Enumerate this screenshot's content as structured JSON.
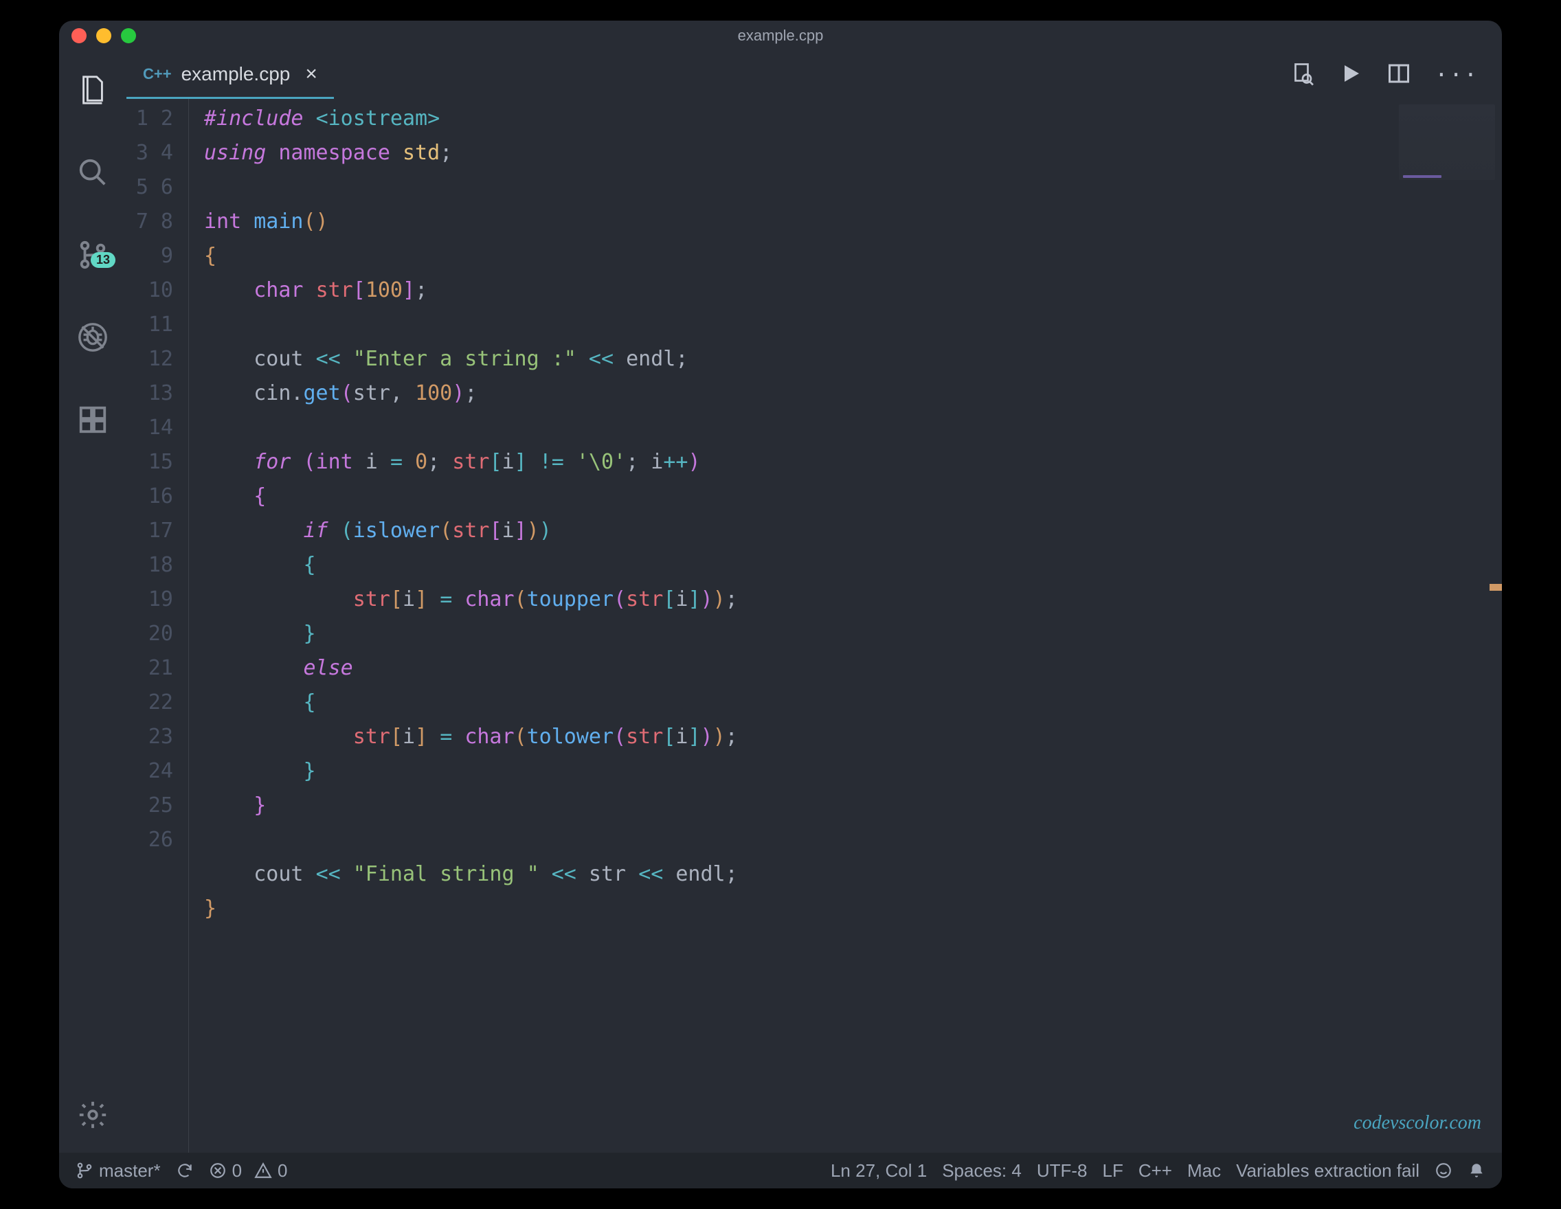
{
  "window": {
    "title": "example.cpp"
  },
  "tab": {
    "lang_badge": "C++",
    "filename": "example.cpp"
  },
  "activitybar": {
    "scm_badge": "13"
  },
  "code": {
    "lines": 26,
    "tokens": [
      [
        [
          "c-pink",
          "#include"
        ],
        [
          "c-white",
          " "
        ],
        [
          "c-cyan",
          "<iostream>"
        ]
      ],
      [
        [
          "c-pink",
          "using"
        ],
        [
          "c-white",
          " "
        ],
        [
          "c-pink-n",
          "namespace"
        ],
        [
          "c-white",
          " "
        ],
        [
          "c-yellow",
          "std"
        ],
        [
          "c-white",
          ";"
        ]
      ],
      [],
      [
        [
          "c-pink-n",
          "int"
        ],
        [
          "c-white",
          " "
        ],
        [
          "c-blue",
          "main"
        ],
        [
          "br1",
          "()"
        ]
      ],
      [
        [
          "br1",
          "{"
        ]
      ],
      [
        [
          "c-white",
          "    "
        ],
        [
          "c-pink-n",
          "char"
        ],
        [
          "c-white",
          " "
        ],
        [
          "c-red",
          "str"
        ],
        [
          "br2",
          "["
        ],
        [
          "c-orange",
          "100"
        ],
        [
          "br2",
          "]"
        ],
        [
          "c-white",
          ";"
        ]
      ],
      [],
      [
        [
          "c-white",
          "    cout "
        ],
        [
          "c-cyan",
          "<<"
        ],
        [
          "c-white",
          " "
        ],
        [
          "c-green",
          "\"Enter a string :\""
        ],
        [
          "c-white",
          " "
        ],
        [
          "c-cyan",
          "<<"
        ],
        [
          "c-white",
          " endl;"
        ]
      ],
      [
        [
          "c-white",
          "    cin."
        ],
        [
          "c-blue",
          "get"
        ],
        [
          "br2",
          "("
        ],
        [
          "c-white",
          "str, "
        ],
        [
          "c-orange",
          "100"
        ],
        [
          "br2",
          ")"
        ],
        [
          "c-white",
          ";"
        ]
      ],
      [],
      [
        [
          "c-white",
          "    "
        ],
        [
          "c-pink",
          "for"
        ],
        [
          "c-white",
          " "
        ],
        [
          "br2",
          "("
        ],
        [
          "c-pink-n",
          "int"
        ],
        [
          "c-white",
          " i "
        ],
        [
          "c-cyan",
          "="
        ],
        [
          "c-white",
          " "
        ],
        [
          "c-orange",
          "0"
        ],
        [
          "c-white",
          "; "
        ],
        [
          "c-red",
          "str"
        ],
        [
          "br3",
          "["
        ],
        [
          "c-white",
          "i"
        ],
        [
          "br3",
          "]"
        ],
        [
          "c-white",
          " "
        ],
        [
          "c-cyan",
          "!="
        ],
        [
          "c-white",
          " "
        ],
        [
          "c-green",
          "'\\0'"
        ],
        [
          "c-white",
          "; i"
        ],
        [
          "c-cyan",
          "++"
        ],
        [
          "br2",
          ")"
        ]
      ],
      [
        [
          "c-white",
          "    "
        ],
        [
          "br2",
          "{"
        ]
      ],
      [
        [
          "c-white",
          "        "
        ],
        [
          "c-pink",
          "if"
        ],
        [
          "c-white",
          " "
        ],
        [
          "br3",
          "("
        ],
        [
          "c-blue",
          "islower"
        ],
        [
          "br1",
          "("
        ],
        [
          "c-red",
          "str"
        ],
        [
          "br2",
          "["
        ],
        [
          "c-white",
          "i"
        ],
        [
          "br2",
          "]"
        ],
        [
          "br1",
          ")"
        ],
        [
          "br3",
          ")"
        ]
      ],
      [
        [
          "c-white",
          "        "
        ],
        [
          "br3",
          "{"
        ]
      ],
      [
        [
          "c-white",
          "            "
        ],
        [
          "c-red",
          "str"
        ],
        [
          "br1",
          "["
        ],
        [
          "c-white",
          "i"
        ],
        [
          "br1",
          "]"
        ],
        [
          "c-white",
          " "
        ],
        [
          "c-cyan",
          "="
        ],
        [
          "c-white",
          " "
        ],
        [
          "c-pink-n",
          "char"
        ],
        [
          "br1",
          "("
        ],
        [
          "c-blue",
          "toupper"
        ],
        [
          "br2",
          "("
        ],
        [
          "c-red",
          "str"
        ],
        [
          "br3",
          "["
        ],
        [
          "c-white",
          "i"
        ],
        [
          "br3",
          "]"
        ],
        [
          "br2",
          ")"
        ],
        [
          "br1",
          ")"
        ],
        [
          "c-white",
          ";"
        ]
      ],
      [
        [
          "c-white",
          "        "
        ],
        [
          "br3",
          "}"
        ]
      ],
      [
        [
          "c-white",
          "        "
        ],
        [
          "c-pink",
          "else"
        ]
      ],
      [
        [
          "c-white",
          "        "
        ],
        [
          "br3",
          "{"
        ]
      ],
      [
        [
          "c-white",
          "            "
        ],
        [
          "c-red",
          "str"
        ],
        [
          "br1",
          "["
        ],
        [
          "c-white",
          "i"
        ],
        [
          "br1",
          "]"
        ],
        [
          "c-white",
          " "
        ],
        [
          "c-cyan",
          "="
        ],
        [
          "c-white",
          " "
        ],
        [
          "c-pink-n",
          "char"
        ],
        [
          "br1",
          "("
        ],
        [
          "c-blue",
          "tolower"
        ],
        [
          "br2",
          "("
        ],
        [
          "c-red",
          "str"
        ],
        [
          "br3",
          "["
        ],
        [
          "c-white",
          "i"
        ],
        [
          "br3",
          "]"
        ],
        [
          "br2",
          ")"
        ],
        [
          "br1",
          ")"
        ],
        [
          "c-white",
          ";"
        ]
      ],
      [
        [
          "c-white",
          "        "
        ],
        [
          "br3",
          "}"
        ]
      ],
      [
        [
          "c-white",
          "    "
        ],
        [
          "br2",
          "}"
        ]
      ],
      [],
      [
        [
          "c-white",
          "    cout "
        ],
        [
          "c-cyan",
          "<<"
        ],
        [
          "c-white",
          " "
        ],
        [
          "c-green",
          "\"Final string \""
        ],
        [
          "c-white",
          " "
        ],
        [
          "c-cyan",
          "<<"
        ],
        [
          "c-white",
          " str "
        ],
        [
          "c-cyan",
          "<<"
        ],
        [
          "c-white",
          " endl;"
        ]
      ],
      [
        [
          "br1",
          "}"
        ]
      ],
      [],
      []
    ]
  },
  "watermark": "codevscolor.com",
  "status": {
    "branch": "master*",
    "errors": "0",
    "warnings": "0",
    "cursor": "Ln 27, Col 1",
    "spaces": "Spaces: 4",
    "encoding": "UTF-8",
    "eol": "LF",
    "lang": "C++",
    "os": "Mac",
    "ext": "Variables extraction fail"
  }
}
